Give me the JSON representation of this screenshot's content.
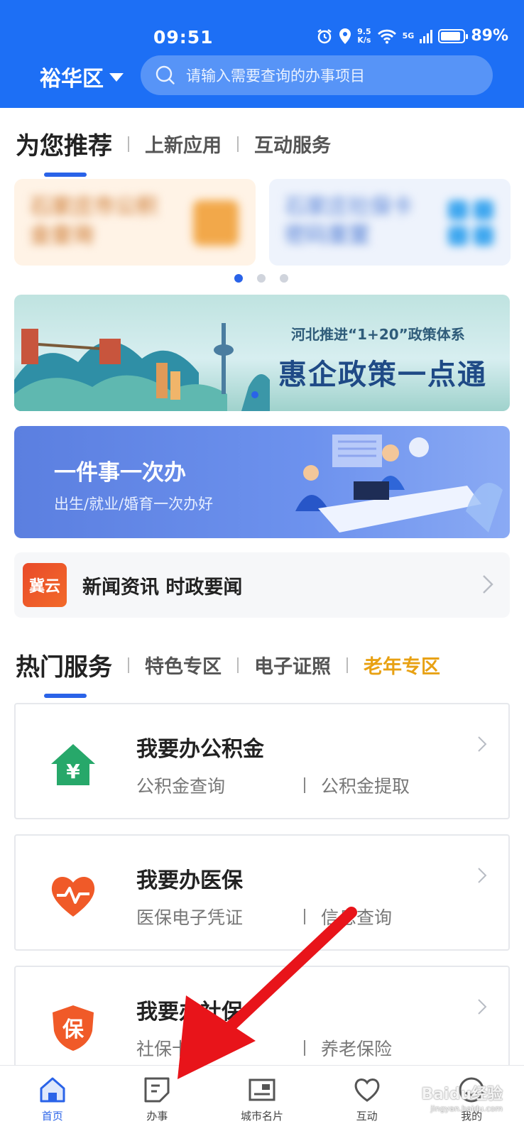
{
  "status_bar": {
    "time": "09:51",
    "speed_value": "9.5",
    "speed_unit": "K/s",
    "network": "5G",
    "battery": "89%"
  },
  "header": {
    "region": "裕华区",
    "search_placeholder": "请输入需要查询的办事项目"
  },
  "rec_tabs": [
    "为您推荐",
    "上新应用",
    "互动服务"
  ],
  "rec_cards": [
    {
      "title": "石家庄市公积金查询",
      "line1": "石家庄市公积",
      "line2": "金查询"
    },
    {
      "title": "石家庄社保卡密码重置",
      "line1": "石家庄社保卡",
      "line2": "密码重置"
    }
  ],
  "banner": {
    "line1": "河北推进“1+20”政策体系",
    "line2": "惠企政策一点通"
  },
  "onething": {
    "title": "一件事一次办",
    "subtitle": "出生/就业/婚育一次办好"
  },
  "news": {
    "logo": "冀云",
    "label": "新闻资讯 时政要闻"
  },
  "hot_tabs": [
    "热门服务",
    "特色专区",
    "电子证照",
    "老年专区"
  ],
  "services": [
    {
      "title": "我要办公积金",
      "sub1": "公积金查询",
      "sub2": "公积金提取",
      "icon": "house-yuan-icon",
      "color": "#27a86a"
    },
    {
      "title": "我要办医保",
      "sub1": "医保电子凭证",
      "sub2": "信息查询",
      "icon": "heart-pulse-icon",
      "color": "#f05a28"
    },
    {
      "title": "我要办社保",
      "sub1": "社保卡",
      "sub2": "养老保险",
      "icon": "shield-icon",
      "color": "#f05a28",
      "badge": "保"
    }
  ],
  "nav": [
    {
      "label": "首页",
      "icon": "home-icon",
      "active": true
    },
    {
      "label": "办事",
      "icon": "document-icon"
    },
    {
      "label": "城市名片",
      "icon": "card-icon"
    },
    {
      "label": "互动",
      "icon": "heart-icon"
    },
    {
      "label": "我的",
      "icon": "profile-icon"
    }
  ],
  "watermark": {
    "text": "Baidu经验",
    "url": "jingyan.baidu.com"
  },
  "colors": {
    "primary": "#1d6ff5",
    "accent": "#2a63e8",
    "gold": "#e8a113",
    "annotation_arrow": "#e8141a"
  }
}
